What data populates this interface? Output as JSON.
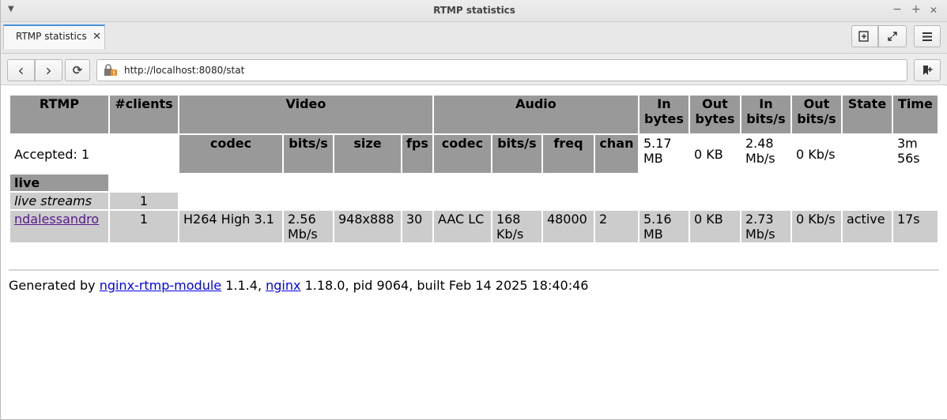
{
  "window": {
    "title": "RTMP statistics",
    "controls": {
      "minimize": "−",
      "maximize": "+",
      "close": "✕"
    }
  },
  "tabs": [
    {
      "label": "RTMP statistics",
      "close": "✕"
    }
  ],
  "toolbar": {
    "new_tab_icon": "new-tab-icon",
    "fullscreen_icon": "expand-icon",
    "menu_icon": "hamburger-menu-icon"
  },
  "nav": {
    "back": "‹",
    "forward": "›",
    "reload": "⟳",
    "url": "http://localhost:8080/stat",
    "bookmark_icon": "bookmark-add-icon"
  },
  "stats_table": {
    "headers": {
      "rtmp": "RTMP",
      "clients": "#clients",
      "video": "Video",
      "audio": "Audio",
      "in_bytes": "In bytes",
      "out_bytes": "Out bytes",
      "in_bits": "In bits/s",
      "out_bits": "Out bits/s",
      "state": "State",
      "time": "Time"
    },
    "subheaders": {
      "codec": "codec",
      "bits": "bits/s",
      "size": "size",
      "fps": "fps",
      "acodec": "codec",
      "abits": "bits/s",
      "freq": "freq",
      "chan": "chan"
    },
    "server": {
      "accepted": "Accepted: 1",
      "in_bytes": "5.17 MB",
      "out_bytes": "0 KB",
      "in_bits": "2.48 Mb/s",
      "out_bits": "0 Kb/s",
      "time": "3m 56s"
    },
    "app": {
      "name": "live",
      "streams_label": "live streams",
      "streams_count": "1"
    },
    "stream": {
      "name": "ndalessandro",
      "clients": "1",
      "video_codec": "H264 High 3.1",
      "video_bits": "2.56 Mb/s",
      "size": "948x888",
      "fps": "30",
      "audio_codec": "AAC LC",
      "audio_bits": "168 Kb/s",
      "freq": "48000",
      "chan": "2",
      "in_bytes": "5.16 MB",
      "out_bytes": "0 KB",
      "in_bits": "2.73 Mb/s",
      "out_bits": "0 Kb/s",
      "state": "active",
      "time": "17s"
    }
  },
  "footer": {
    "prefix": "Generated by",
    "module_link": "nginx-rtmp-module",
    "module_version": "1.1.4,",
    "nginx_link": "nginx",
    "rest": "1.18.0, pid 9064, built Feb 14 2025 18:40:46"
  }
}
